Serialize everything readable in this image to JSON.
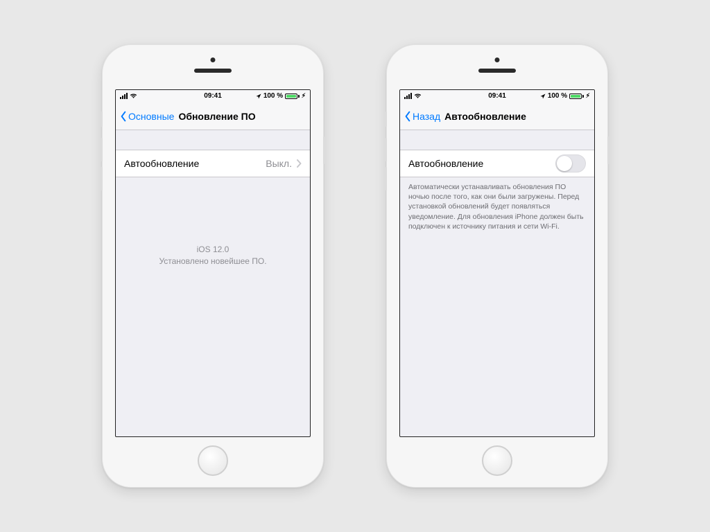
{
  "statusbar": {
    "time": "09:41",
    "battery_pct": "100 %"
  },
  "phone_left": {
    "nav_back_label": "Основные",
    "nav_title": "Обновление ПО",
    "row_auto_label": "Автообновление",
    "row_auto_value": "Выкл.",
    "status_line1": "iOS 12.0",
    "status_line2": "Установлено новейшее ПО."
  },
  "phone_right": {
    "nav_back_label": "Назад",
    "nav_title": "Автообновление",
    "row_auto_label": "Автообновление",
    "toggle_on": false,
    "footer_text": "Автоматически устанавливать обновления ПО ночью после того, как они были загружены. Перед установкой обновлений будет появляться уведомление. Для обновления iPhone должен быть подключен к источнику питания и сети Wi-Fi."
  }
}
